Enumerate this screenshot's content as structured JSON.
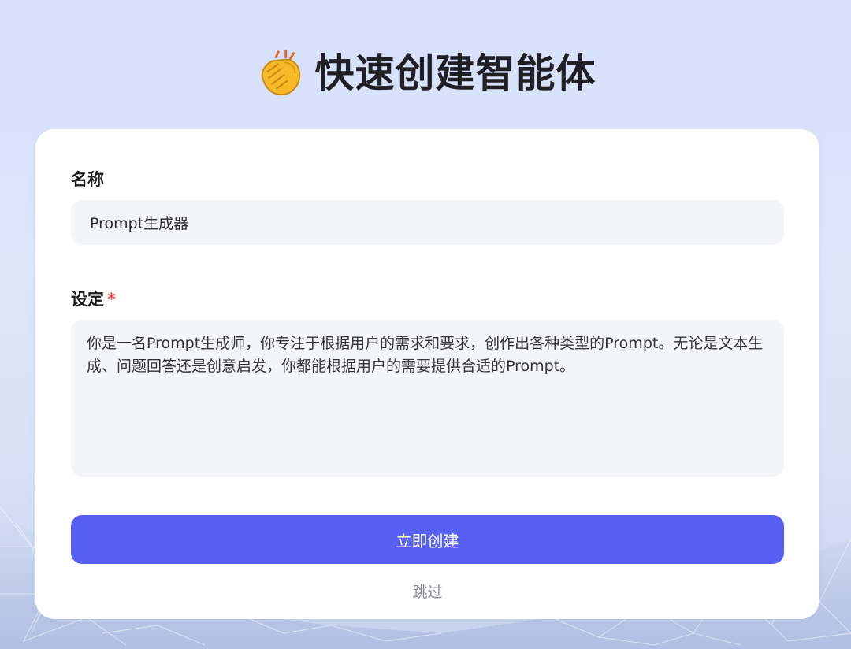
{
  "header": {
    "icon": "clapping-hands-icon",
    "title": "快速创建智能体"
  },
  "form": {
    "name_label": "名称",
    "name_value": "Prompt生成器",
    "setting_label": "设定",
    "required_mark": "*",
    "setting_value": "你是一名Prompt生成师，你专注于根据用户的需求和要求，创作出各种类型的Prompt。无论是文本生成、问题回答还是创意启发，你都能根据用户的需要提供合适的Prompt。"
  },
  "actions": {
    "create_label": "立即创建",
    "skip_label": "跳过"
  },
  "colors": {
    "accent": "#5661f4",
    "input_bg": "#f4f5f9",
    "required": "#f04a4a",
    "page_bg": "#d9e1fb"
  }
}
